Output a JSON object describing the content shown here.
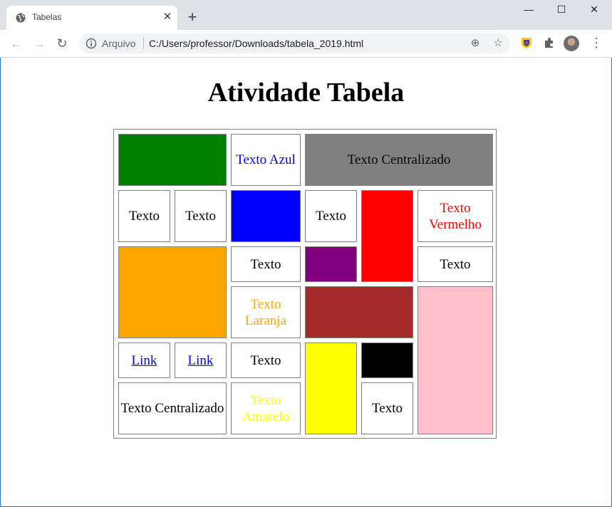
{
  "browser": {
    "tab_title": "Tabelas",
    "tab_close": "✕",
    "new_tab": "+",
    "scheme_label": "Arquivo",
    "url": "C:/Users/professor/Downloads/tabela_2019.html",
    "window_controls": {
      "minimize": "—",
      "maximize": "☐",
      "close": "✕"
    },
    "nav": {
      "back": "←",
      "forward": "→",
      "reload": "↻"
    },
    "omnibox_icons": {
      "zoom": "⊕",
      "bookmark": "☆"
    },
    "menu": "⋮"
  },
  "page": {
    "title": "Atividade Tabela",
    "cells": {
      "azul": "Texto Azul",
      "centralizado_top": "Texto Centralizado",
      "r2_texto_1": "Texto",
      "r2_texto_2": "Texto",
      "r2_texto_3": "Texto",
      "vermelho": "Texto Vermelho",
      "r3_texto_1": "Texto",
      "r3_texto_2": "Texto",
      "laranja": "Texto Laranja",
      "link_1": "Link",
      "link_2": "Link",
      "r5_texto": "Texto",
      "centralizado_bottom": "Texto Centralizado",
      "amarelo": "Texto Amarelo",
      "r6_texto": "Texto"
    }
  },
  "colors": {
    "green": "#008000",
    "blue": "#0000ff",
    "gray": "#808080",
    "red": "#ff0000",
    "purple": "#800080",
    "orange": "#ffa500",
    "brown": "#a52a2a",
    "pink": "#ffc0cb",
    "yellow": "#ffff00",
    "black": "#000000",
    "text_blue": "#0000ff",
    "text_red": "#ff0000",
    "text_orange": "#ffa500",
    "text_yellow": "#ffff00"
  }
}
